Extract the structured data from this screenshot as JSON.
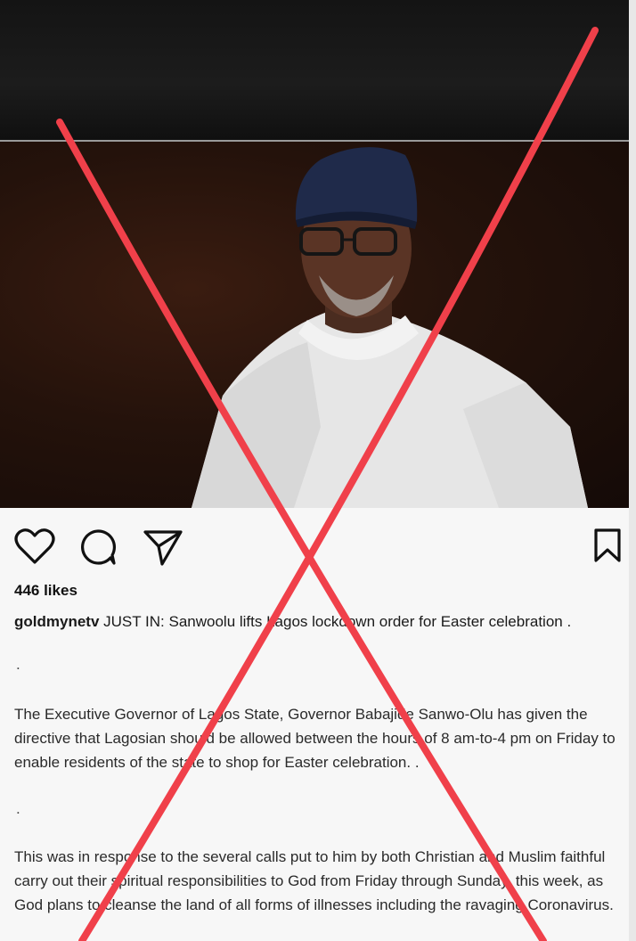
{
  "post": {
    "likes": "446 likes",
    "username": "goldmynetv",
    "caption_line": " JUST IN: Sanwoolu lifts Lagos lockdown order for Easter celebration .",
    "separator": ".",
    "paragraph1": "The Executive Governor of Lagos State, Governor Babajide Sanwo-Olu has given the directive that Lagosian should be allowed between the hours of 8 am-to-4 pm on Friday to enable residents of the state to shop for Easter celebration. .",
    "paragraph2": "This was in response to the several calls put to him by both Christian and Muslim faithful carry out their spiritual responsibilities to God from Friday through Sunday, this week, as God plans to cleanse the land of all forms of illnesses including the ravaging Coronavirus."
  },
  "icons": {
    "like": "heart-icon",
    "comment": "comment-icon",
    "share": "send-icon",
    "save": "bookmark-icon"
  },
  "colors": {
    "cross": "#f0404a",
    "cap": "#1f2a4a",
    "agbada": "#ededed"
  }
}
